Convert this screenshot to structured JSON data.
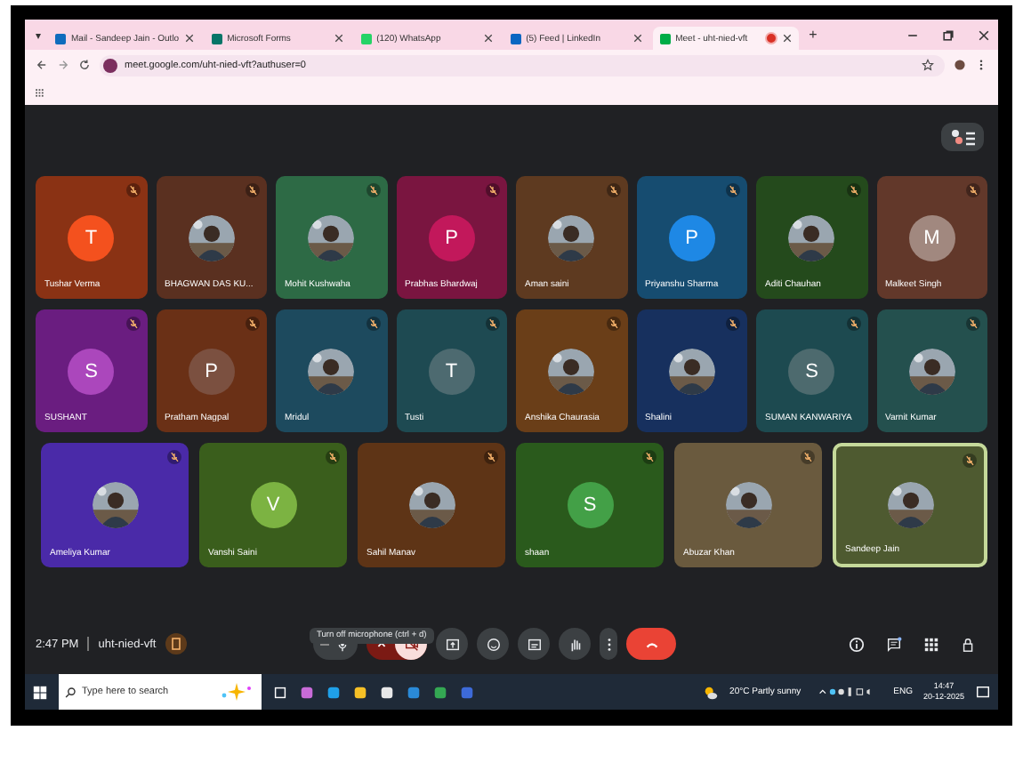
{
  "browser": {
    "tab_list": "▾",
    "tabs": [
      {
        "title": "Mail - Sandeep Jain - Outlo",
        "kind": "mail",
        "selected": false,
        "recording": false
      },
      {
        "title": "Microsoft Forms",
        "kind": "forms",
        "selected": false,
        "recording": false
      },
      {
        "title": "(120) WhatsApp",
        "kind": "chat",
        "selected": false,
        "recording": false
      },
      {
        "title": "(5) Feed | LinkedIn",
        "kind": "social",
        "selected": false,
        "recording": false
      },
      {
        "title": "Meet - uht-nied-vft",
        "kind": "meet",
        "selected": true,
        "recording": true
      }
    ],
    "new_tab": "+",
    "address": "meet.google.com/uht-nied-vft?authuser=0"
  },
  "rows": [
    [
      {
        "name": "Tushar Verma",
        "color": "#8a3214",
        "avatar": {
          "kind": "letter",
          "letter": "T",
          "color": "#f4511e"
        },
        "speaking": false
      },
      {
        "name": "BHAGWAN DAS KU...",
        "color": "#5a3020",
        "speaking": false
      },
      {
        "name": "Mohit Kushwaha",
        "color": "#2d6a45",
        "speaking": false
      },
      {
        "name": "Prabhas Bhardwaj",
        "color": "#7a1540",
        "avatar": {
          "kind": "letter",
          "letter": "P",
          "color": "#c2185b"
        },
        "speaking": false
      },
      {
        "name": "Aman saini",
        "color": "#5e3a20",
        "speaking": false
      },
      {
        "name": "Priyanshu Sharma",
        "color": "#164c70",
        "avatar": {
          "kind": "letter",
          "letter": "P",
          "color": "#1e88e5"
        },
        "speaking": false
      },
      {
        "name": "Aditi Chauhan",
        "color": "#244a1c",
        "speaking": false
      },
      {
        "name": "Malkeet Singh",
        "color": "#62382a",
        "avatar": {
          "kind": "letter",
          "letter": "M",
          "color": "#a1887f"
        },
        "speaking": false
      }
    ],
    [
      {
        "name": "SUSHANT",
        "color": "#6a1d80",
        "avatar": {
          "kind": "letter",
          "letter": "S",
          "color": "#ab47bc"
        },
        "speaking": false
      },
      {
        "name": "Pratham Nagpal",
        "color": "#6a3016",
        "avatar": {
          "kind": "letter",
          "letter": "P",
          "color": "#7b5040"
        },
        "speaking": false
      },
      {
        "name": "Mridul",
        "color": "#1d4a5e",
        "speaking": false
      },
      {
        "name": "Tusti",
        "color": "#1e4a52",
        "avatar": {
          "kind": "letter",
          "letter": "T",
          "color": "#4d6a70"
        },
        "speaking": false
      },
      {
        "name": "Anshika Chaurasia",
        "color": "#6a3e18",
        "speaking": false
      },
      {
        "name": "Shalini",
        "color": "#17305e",
        "speaking": false
      },
      {
        "name": "SUMAN KANWARIYA",
        "color": "#1d4a50",
        "avatar": {
          "kind": "letter",
          "letter": "S",
          "color": "#4d6a6e"
        },
        "speaking": false
      },
      {
        "name": "Varnit Kumar",
        "color": "#24504e",
        "speaking": false
      }
    ],
    [
      {
        "name": "Ameliya Kumar",
        "color": "#4a2aa8",
        "speaking": false
      },
      {
        "name": "Vanshi Saini",
        "color": "#3a5e1c",
        "avatar": {
          "kind": "letter",
          "letter": "V",
          "color": "#7cb342"
        },
        "speaking": false
      },
      {
        "name": "Sahil Manav",
        "color": "#5e3416",
        "speaking": false
      },
      {
        "name": "shaan",
        "color": "#2a5a1c",
        "avatar": {
          "kind": "letter",
          "letter": "S",
          "color": "#43a047"
        },
        "speaking": false
      },
      {
        "name": "Abuzar Khan",
        "color": "#6a5a3e",
        "speaking": false
      },
      {
        "name": "Sandeep Jain",
        "color": "#4e5a30",
        "speaking": true
      }
    ]
  ],
  "controls": {
    "time": "2:47 PM",
    "meeting_code": "uht-nied-vft",
    "tooltip": "Turn off microphone (ctrl + d)",
    "mic_on": true,
    "camera_on": false
  },
  "taskbar": {
    "search_placeholder": "Type here to search",
    "weather": "20°C  Partly sunny",
    "language": "ENG",
    "clock_time": "14:47",
    "clock_date": "20-12-2025"
  }
}
